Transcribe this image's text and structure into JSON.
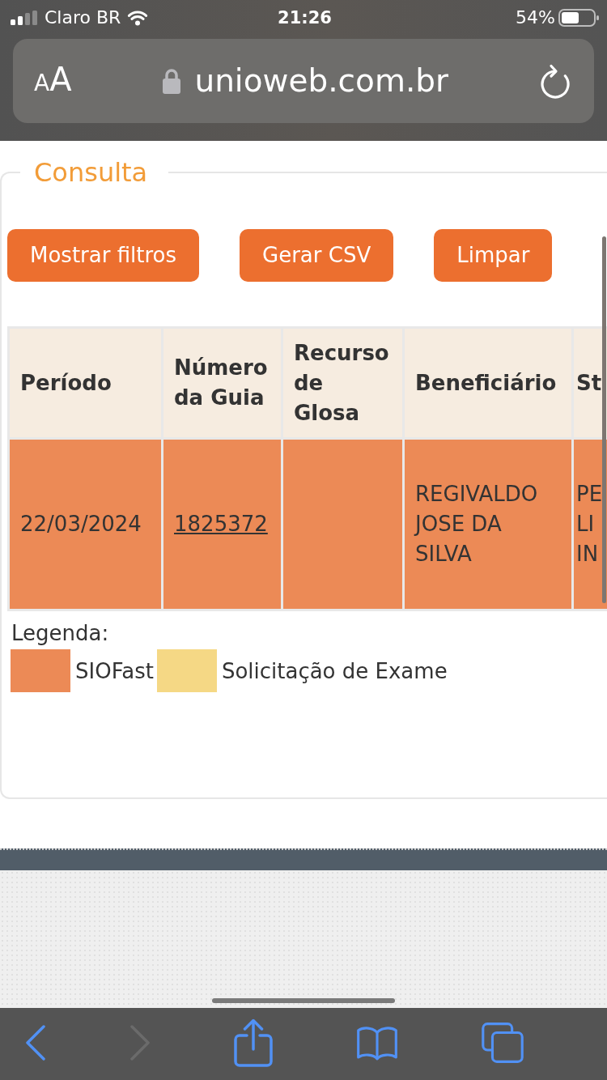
{
  "status_bar": {
    "carrier": "Claro BR",
    "time": "21:26",
    "battery": "54%"
  },
  "address_bar": {
    "text_size_button": "AA",
    "url": "unioweb.com.br"
  },
  "panel": {
    "title": "Consulta",
    "buttons": [
      "Mostrar filtros",
      "Gerar CSV",
      "Limpar"
    ],
    "table": {
      "columns": [
        "Período",
        "Número da Guia",
        "Recurso de Glosa",
        "Beneficiário",
        "St"
      ],
      "rows": [
        {
          "color": "#ec8a56",
          "cells": [
            {
              "text": "22/03/2024",
              "link": false
            },
            {
              "text": "1825372",
              "link": true
            },
            {},
            {
              "text": "REGIVALDO JOSE DA SILVA",
              "link": false
            },
            {
              "text": "PE LI IN",
              "link": false
            }
          ]
        }
      ]
    },
    "legend": {
      "title": "Legenda:",
      "items": [
        {
          "label": "SIOFast",
          "color": "#ec8a56"
        },
        {
          "label": "Solicitação de Exame",
          "color": "#f5d885"
        }
      ]
    }
  },
  "toolbar": [
    {
      "kind": "back",
      "disabled": false
    },
    {
      "kind": "forward",
      "disabled": true
    },
    {
      "kind": "share",
      "disabled": false
    },
    {
      "kind": "bookmarks",
      "disabled": false
    },
    {
      "kind": "tabs",
      "disabled": false
    }
  ]
}
